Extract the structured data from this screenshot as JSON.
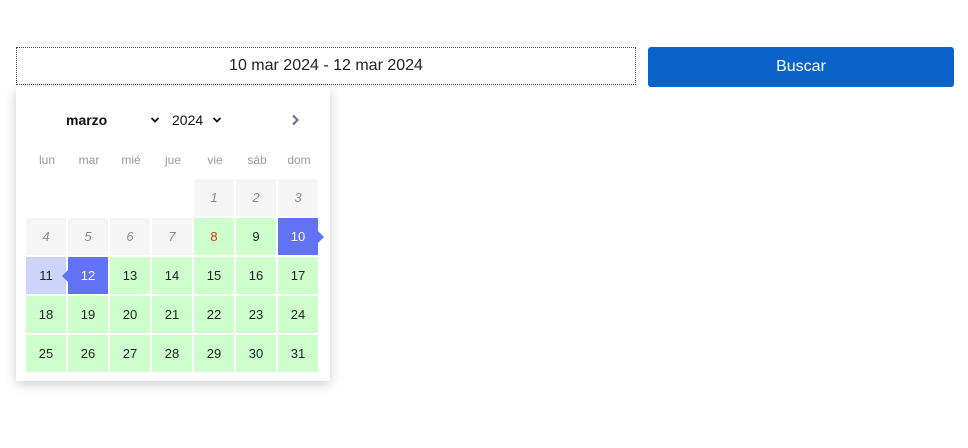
{
  "date_range": {
    "value": "10 mar 2024 - 12 mar 2024"
  },
  "search_button": {
    "label": "Buscar"
  },
  "calendar": {
    "month": "marzo",
    "year": "2024",
    "weekdays": [
      "lun",
      "mar",
      "mié",
      "jue",
      "vie",
      "sáb",
      "dom"
    ],
    "leading_blanks": 4,
    "today": 8,
    "range_start": 10,
    "range_end": 12,
    "days": [
      {
        "label": "1",
        "state": "past"
      },
      {
        "label": "2",
        "state": "past"
      },
      {
        "label": "3",
        "state": "past"
      },
      {
        "label": "4",
        "state": "past"
      },
      {
        "label": "5",
        "state": "past"
      },
      {
        "label": "6",
        "state": "past"
      },
      {
        "label": "7",
        "state": "past"
      },
      {
        "label": "8",
        "state": "available"
      },
      {
        "label": "9",
        "state": "available"
      },
      {
        "label": "10",
        "state": "selected-start"
      },
      {
        "label": "11",
        "state": "in-range"
      },
      {
        "label": "12",
        "state": "selected-end"
      },
      {
        "label": "13",
        "state": "available"
      },
      {
        "label": "14",
        "state": "available"
      },
      {
        "label": "15",
        "state": "available"
      },
      {
        "label": "16",
        "state": "available"
      },
      {
        "label": "17",
        "state": "available"
      },
      {
        "label": "18",
        "state": "available"
      },
      {
        "label": "19",
        "state": "available"
      },
      {
        "label": "20",
        "state": "available"
      },
      {
        "label": "21",
        "state": "available"
      },
      {
        "label": "22",
        "state": "available"
      },
      {
        "label": "23",
        "state": "available"
      },
      {
        "label": "24",
        "state": "available"
      },
      {
        "label": "25",
        "state": "available"
      },
      {
        "label": "26",
        "state": "available"
      },
      {
        "label": "27",
        "state": "available"
      },
      {
        "label": "28",
        "state": "available"
      },
      {
        "label": "29",
        "state": "available"
      },
      {
        "label": "30",
        "state": "available"
      },
      {
        "label": "31",
        "state": "available"
      }
    ]
  },
  "colors": {
    "button": "#0a63c9",
    "selected": "#6272f5",
    "in_range": "#cdd4fb",
    "available": "#ccffcc",
    "past": "#f5f5f5",
    "today_text": "#d93025"
  },
  "icons": {
    "month_dropdown": "chevron-down-icon",
    "year_dropdown": "chevron-down-icon",
    "next_month": "chevron-right-icon"
  }
}
